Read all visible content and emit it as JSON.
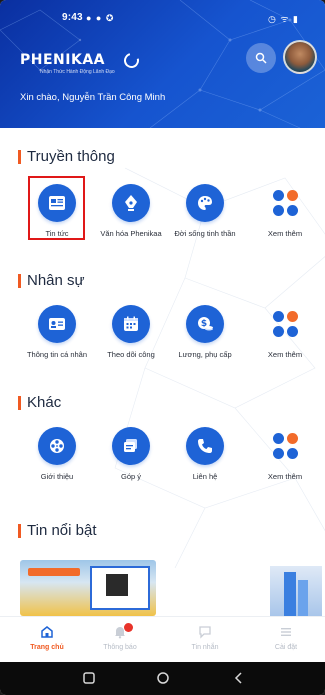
{
  "status": {
    "time": "9:43",
    "icons": "● ● ✪",
    "right_icons": "◷ ᯤ ▮"
  },
  "header": {
    "brand": "PHENIKAA",
    "slogan": "Nhận Thức Hành Động Lãnh Đạo",
    "greeting": "Xin chào, Nguyễn Trần Công Minh"
  },
  "sections": {
    "media": {
      "title": "Truyền thông",
      "items": [
        {
          "label": "Tin tức",
          "icon": "news-icon"
        },
        {
          "label": "Văn hóa Phenikaa",
          "icon": "pen-nib-icon"
        },
        {
          "label": "Đời sống tinh thần",
          "icon": "palette-icon"
        },
        {
          "label": "Xem thêm",
          "icon": "more-dots-icon"
        }
      ]
    },
    "hr": {
      "title": "Nhân sự",
      "items": [
        {
          "label": "Thông tin cá nhân",
          "icon": "id-card-icon"
        },
        {
          "label": "Theo dõi công",
          "icon": "calendar-icon"
        },
        {
          "label": "Lương, phụ cấp",
          "icon": "salary-icon"
        },
        {
          "label": "Xem thêm",
          "icon": "more-dots-icon"
        }
      ]
    },
    "other": {
      "title": "Khác",
      "items": [
        {
          "label": "Giới thiệu",
          "icon": "film-reel-icon"
        },
        {
          "label": "Góp ý",
          "icon": "feedback-icon"
        },
        {
          "label": "Liên hệ",
          "icon": "phone-icon"
        },
        {
          "label": "Xem thêm",
          "icon": "more-dots-icon"
        }
      ]
    },
    "news": {
      "title": "Tin nổi bật"
    }
  },
  "bottom_nav": [
    {
      "label": "Trang chủ",
      "icon": "home-icon",
      "active": true
    },
    {
      "label": "Thông báo",
      "icon": "bell-icon",
      "active": false
    },
    {
      "label": "Tin nhắn",
      "icon": "message-icon",
      "active": false
    },
    {
      "label": "Cài đặt",
      "icon": "settings-icon",
      "active": false
    }
  ],
  "colors": {
    "primary": "#1e63d6",
    "accent": "#f05a22",
    "highlight_border": "#e01818",
    "dot_orange": "#f26b2a",
    "dot_blue": "#1e63d6"
  }
}
